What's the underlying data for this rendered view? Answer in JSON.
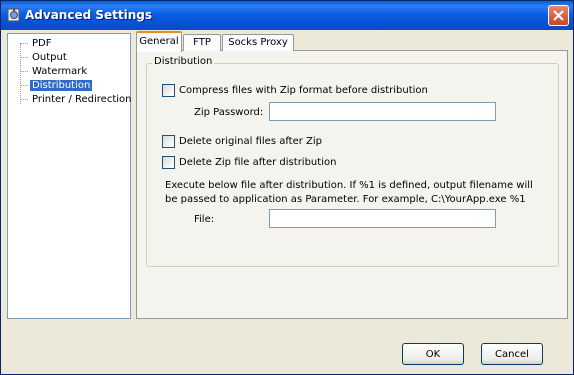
{
  "window": {
    "title": "Advanced Settings"
  },
  "tree": {
    "items": [
      {
        "label": "PDF"
      },
      {
        "label": "Output"
      },
      {
        "label": "Watermark"
      },
      {
        "label": "Distribution",
        "selected": true
      },
      {
        "label": "Printer / Redirection"
      }
    ]
  },
  "tabs": [
    {
      "label": "General",
      "active": true
    },
    {
      "label": "FTP"
    },
    {
      "label": "Socks Proxy"
    }
  ],
  "distribution": {
    "group_title": "Distribution",
    "compress_label": "Compress files with Zip format before distribution",
    "compress_checked": false,
    "zip_password_label": "Zip Password:",
    "zip_password_value": "",
    "delete_original_label": "Delete original files after Zip",
    "delete_original_checked": false,
    "delete_zip_label": "Delete Zip file after distribution",
    "delete_zip_checked": false,
    "execute_note": "Execute below file after distribution. If %1 is defined, output filename will be passed to application as Parameter. For example, C:\\YourApp.exe %1",
    "file_label": "File:",
    "file_value": ""
  },
  "buttons": {
    "ok": "OK",
    "cancel": "Cancel"
  },
  "colors": {
    "titlebar": "#0a5fd9",
    "selection": "#316ac5",
    "tab_accent": "#e68b2c",
    "close_button": "#c8452a"
  }
}
